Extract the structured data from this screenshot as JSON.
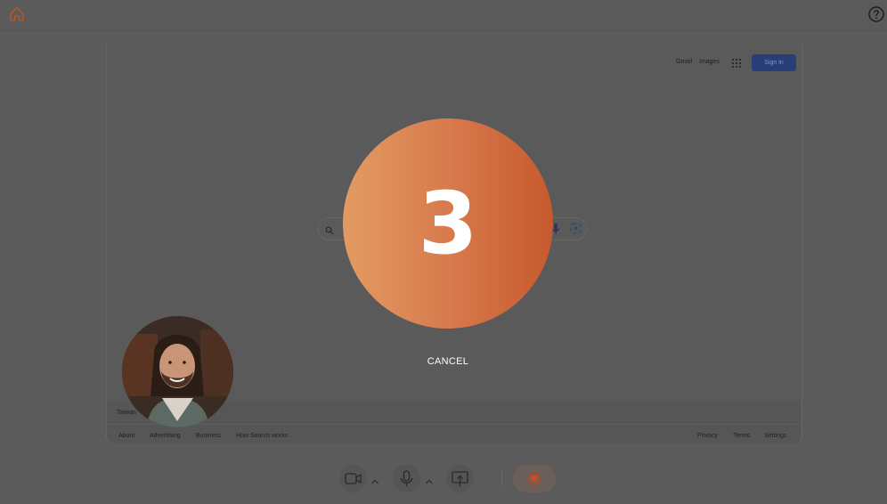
{
  "top_bar": {
    "home_icon": "home-icon",
    "help_icon": "help-icon"
  },
  "browser": {
    "header_links": [
      "Gmail",
      "Images"
    ],
    "apps_icon": "apps-grid-icon",
    "signin_label": "Sign in",
    "region": "Taiwan",
    "footer_left": [
      "About",
      "Advertising",
      "Business",
      "How Search works"
    ],
    "footer_right": [
      "Privacy",
      "Terms",
      "Settings"
    ]
  },
  "countdown": {
    "value": "3",
    "cancel_label": "CANCEL",
    "gradient_start": "#e39b63",
    "gradient_end": "#c65a2e"
  },
  "toolbar": {
    "camera_icon": "video-camera-icon",
    "mic_icon": "microphone-icon",
    "share_icon": "share-screen-icon",
    "record_icon": "record-icon",
    "record_color": "#c4502a"
  }
}
